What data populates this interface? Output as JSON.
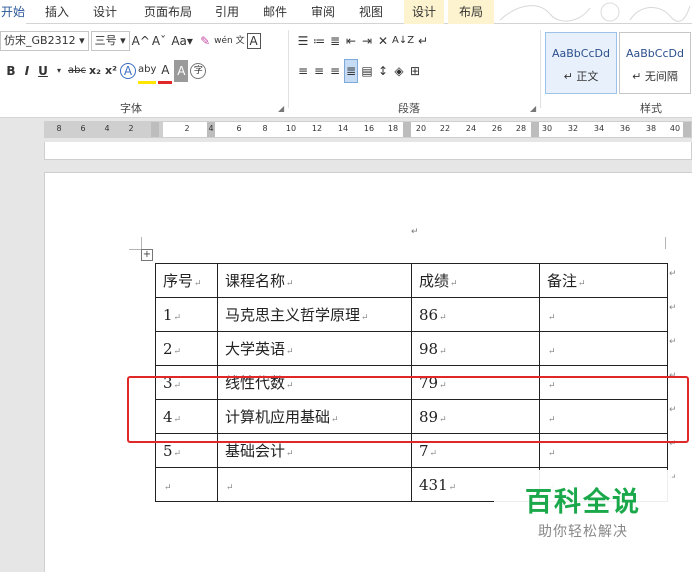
{
  "tabs": [
    "开始",
    "插入",
    "设计",
    "页面布局",
    "引用",
    "邮件",
    "审阅",
    "视图",
    "设计",
    "布局"
  ],
  "font": {
    "name": "仿宋_GB2312",
    "size": "三号",
    "grow_icon": "A^",
    "shrink_icon": "Aˇ",
    "case_label": "Aa",
    "clear_icon": "eraser-icon",
    "phonetic_label": "wén 文",
    "border_char_label": "A",
    "bold": "B",
    "italic": "I",
    "underline": "U",
    "strike": "abc",
    "subscript": "x₂",
    "superscript": "x²",
    "effects": "A",
    "highlight": "aby",
    "font_color": "A",
    "shading": "A",
    "enclose": "字",
    "group_label": "字体"
  },
  "paragraph": {
    "group_label": "段落",
    "sort_label": "A↓Z"
  },
  "styles": {
    "items": [
      {
        "sample": "AaBbCcDd",
        "name": "↵ 正文"
      },
      {
        "sample": "AaBbCcDd",
        "name": "↵ 无间隔"
      }
    ],
    "group_label": "样式"
  },
  "ruler": {
    "numbers": [
      "8",
      "6",
      "4",
      "2",
      "2",
      "4",
      "6",
      "8",
      "10",
      "12",
      "14",
      "16",
      "18",
      "20",
      "22",
      "24",
      "26",
      "28",
      "30",
      "32",
      "34",
      "36",
      "38",
      "40"
    ]
  },
  "doc": {
    "para_mark": "↵",
    "move_handle": "+",
    "table": {
      "header": [
        "序号",
        "课程名称",
        "成绩",
        "备注"
      ],
      "rows": [
        [
          "1",
          "马克思主义哲学原理",
          "86",
          ""
        ],
        [
          "2",
          "大学英语",
          "98",
          ""
        ],
        [
          "3",
          "线性代数",
          "79",
          ""
        ],
        [
          "4",
          "计算机应用基础",
          "89",
          ""
        ],
        [
          "5",
          "基础会计",
          "7",
          ""
        ],
        [
          "",
          "",
          "431",
          ""
        ]
      ]
    }
  },
  "watermark": {
    "title": "百科全说",
    "subtitle": "助你轻松解决"
  },
  "colors": {
    "accent": "#2b579a",
    "highlight_frame": "#e02828",
    "watermark_green": "#1aa84a"
  }
}
